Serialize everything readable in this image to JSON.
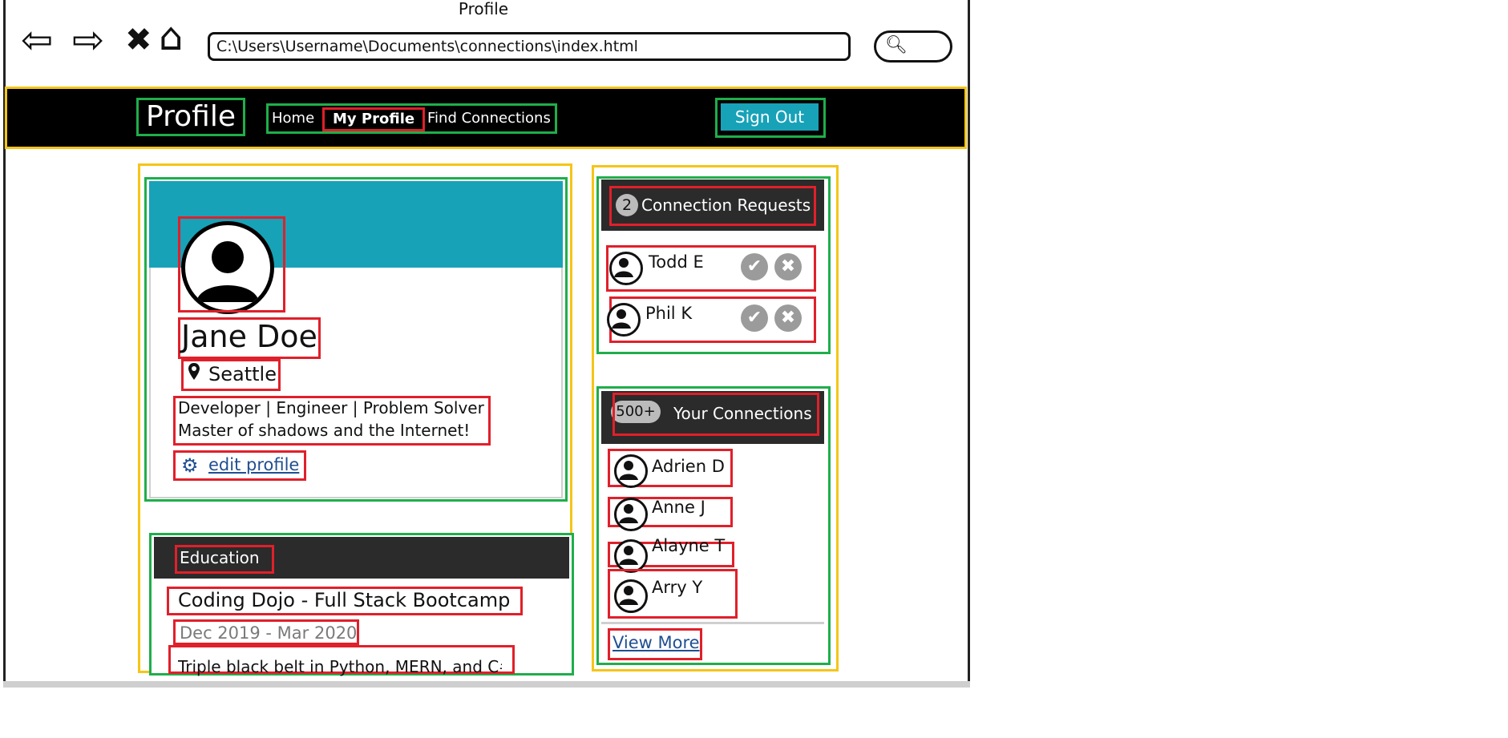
{
  "window": {
    "title": "Profile"
  },
  "browser": {
    "address": "C:\\Users\\Username\\Documents\\connections\\index.html",
    "nav_icons": [
      "back-arrow-icon",
      "forward-arrow-icon",
      "stop-icon",
      "home-icon"
    ]
  },
  "navbar": {
    "brand": "Profile",
    "links": [
      "Home",
      "My Profile",
      "Find Connections"
    ],
    "active_link": "My Profile",
    "sign_out": "Sign Out",
    "accent": "#17a2b8"
  },
  "profile": {
    "name": "Jane Doe",
    "location": "Seattle",
    "bio_lines": [
      "Developer | Engineer | Problem Solver",
      "Master of shadows and the Internet!"
    ],
    "edit_label": "edit profile"
  },
  "education": {
    "title": "Education",
    "school": "Coding Dojo - Full Stack Bootcamp",
    "dates": "Dec 2019 - Mar 2020",
    "description": "Triple black belt in Python, MERN, and C#"
  },
  "requests": {
    "count": "2",
    "title": "Connection Requests",
    "items": [
      "Todd E",
      "Phil K"
    ]
  },
  "connections": {
    "count": "500+",
    "title": "Your Connections",
    "items": [
      "Adrien D",
      "Anne J",
      "Alayne T",
      "Arry Y"
    ],
    "view_more": "View More"
  },
  "colors": {
    "annotation_red": "#e0202a",
    "annotation_green": "#1fae4b",
    "annotation_yellow": "#f5c518",
    "header_dark": "#2b2b2b"
  }
}
